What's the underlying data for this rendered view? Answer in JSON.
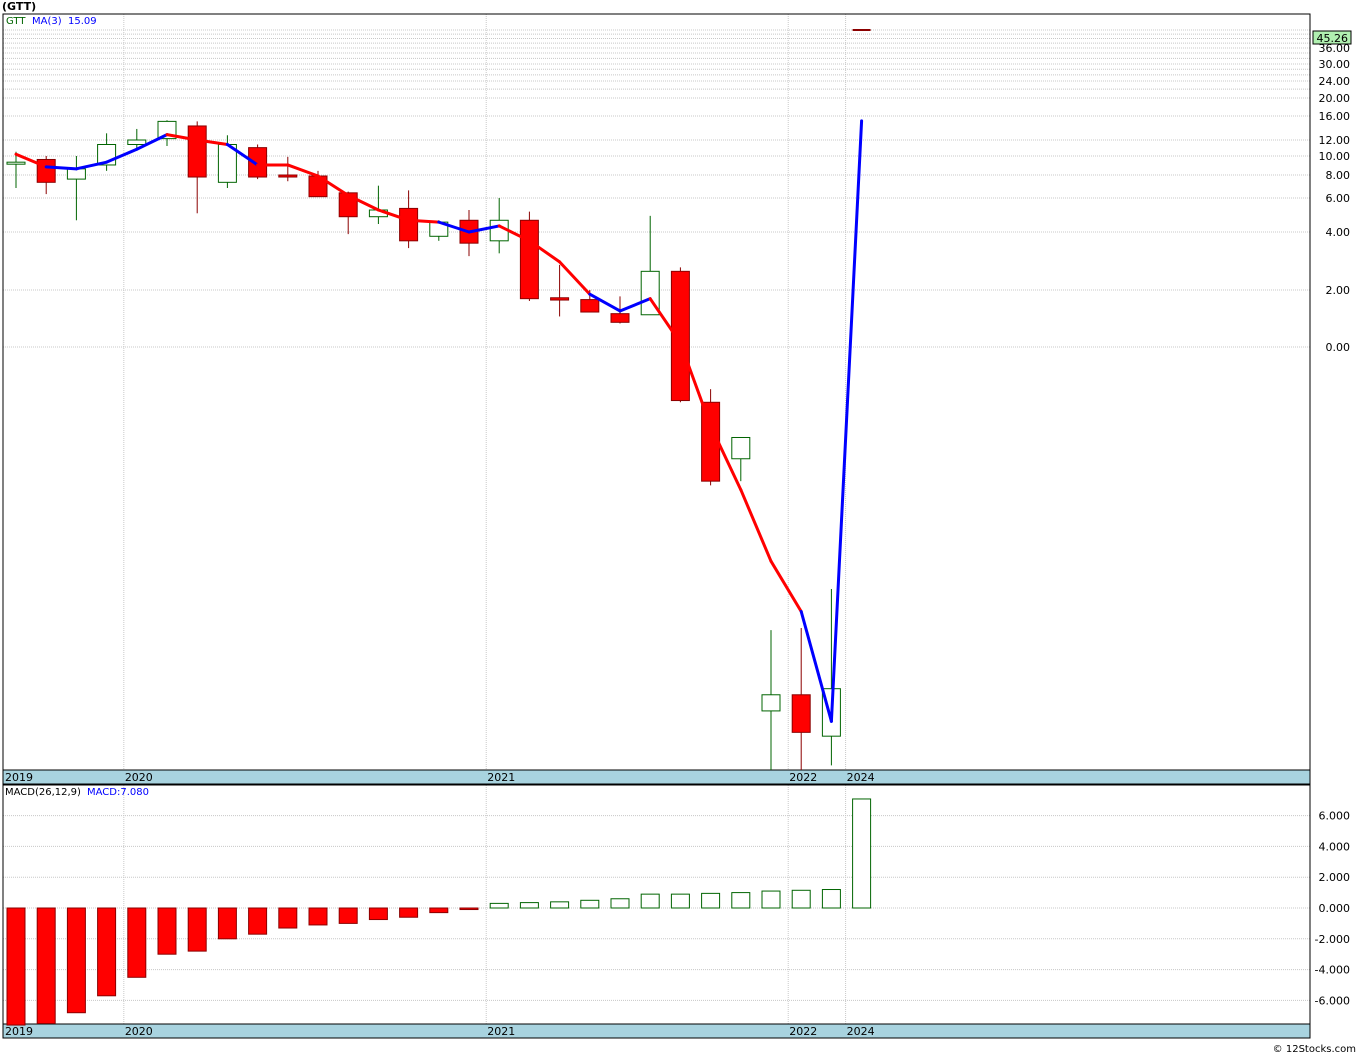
{
  "header": {
    "title": "(GTT)",
    "credit": "© 12Stocks.com"
  },
  "colors": {
    "up": "#006400",
    "down": "#ff0000",
    "ma_down": "#ff0000",
    "ma_up": "#0000ff",
    "axis_band": "#a8d3df",
    "grid": "#c8c8c8",
    "last_price_bg": "#b0f0b0"
  },
  "chart_data": [
    {
      "type": "candlestick",
      "title": "(GTT)",
      "legend": [
        "GTT",
        "MA(3)",
        "15.09"
      ],
      "last_price_label": "45.26",
      "scale": "log",
      "y_ticks": [
        "36.00",
        "30.00",
        "24.00",
        "20.00",
        "16.00",
        "12.00",
        "10.00",
        "8.00",
        "6.00",
        "4.00",
        "2.00",
        "0.00"
      ],
      "x_labels": [
        "2019",
        "2020",
        "2021",
        "2022",
        "2024"
      ],
      "candles": [
        {
          "o": 9.3,
          "h": 10.5,
          "l": 6.8,
          "c": 9.3
        },
        {
          "o": 9.6,
          "h": 10.0,
          "l": 6.3,
          "c": 7.3
        },
        {
          "o": 7.6,
          "h": 10.0,
          "l": 4.6,
          "c": 8.6
        },
        {
          "o": 9.0,
          "h": 13.0,
          "l": 8.4,
          "c": 11.4
        },
        {
          "o": 11.4,
          "h": 13.7,
          "l": 10.8,
          "c": 12.0
        },
        {
          "o": 12.2,
          "h": 15.2,
          "l": 11.2,
          "c": 15.0
        },
        {
          "o": 14.2,
          "h": 15.0,
          "l": 5.0,
          "c": 7.8
        },
        {
          "o": 7.3,
          "h": 12.7,
          "l": 6.8,
          "c": 11.4
        },
        {
          "o": 11.0,
          "h": 11.4,
          "l": 7.6,
          "c": 7.8
        },
        {
          "o": 8.0,
          "h": 9.9,
          "l": 7.4,
          "c": 7.8
        },
        {
          "o": 7.9,
          "h": 8.4,
          "l": 6.1,
          "c": 6.1
        },
        {
          "o": 6.4,
          "h": 6.5,
          "l": 3.9,
          "c": 4.8
        },
        {
          "o": 4.8,
          "h": 7.0,
          "l": 4.4,
          "c": 5.2
        },
        {
          "o": 5.3,
          "h": 6.6,
          "l": 3.3,
          "c": 3.6
        },
        {
          "o": 3.8,
          "h": 4.6,
          "l": 3.6,
          "c": 4.5
        },
        {
          "o": 4.6,
          "h": 5.2,
          "l": 3.0,
          "c": 3.5
        },
        {
          "o": 3.6,
          "h": 6.0,
          "l": 3.1,
          "c": 4.6
        },
        {
          "o": 4.6,
          "h": 5.1,
          "l": 1.75,
          "c": 1.8
        },
        {
          "o": 1.82,
          "h": 2.7,
          "l": 1.45,
          "c": 1.77
        },
        {
          "o": 1.78,
          "h": 2.0,
          "l": 1.55,
          "c": 1.53
        },
        {
          "o": 1.5,
          "h": 1.85,
          "l": 1.33,
          "c": 1.35
        },
        {
          "o": 1.48,
          "h": 4.85,
          "l": 1.48,
          "c": 2.5
        },
        {
          "o": 2.5,
          "h": 2.62,
          "l": 0.58,
          "c": 0.59
        },
        {
          "o": 0.58,
          "h": 0.66,
          "l": 0.27,
          "c": 0.28
        },
        {
          "o": 0.34,
          "h": 0.35,
          "l": 0.28,
          "c": 0.41
        },
        {
          "o": 0.055,
          "h": 0.085,
          "l": 0.035,
          "c": 0.06
        },
        {
          "o": 0.06,
          "h": 0.086,
          "l": 0.035,
          "c": 0.049
        },
        {
          "o": 0.048,
          "h": 0.11,
          "l": 0.041,
          "c": 0.062
        },
        {
          "o": 44.0,
          "h": 44.0,
          "l": 44.0,
          "c": 44.0
        }
      ],
      "ma": [
        10.2,
        8.8,
        8.6,
        9.3,
        10.8,
        12.8,
        12.0,
        11.4,
        9.0,
        9.0,
        7.9,
        6.2,
        5.2,
        4.6,
        4.5,
        4.0,
        4.3,
        3.6,
        2.8,
        1.9,
        1.55,
        1.8,
        1.05,
        0.46,
        0.26,
        0.14,
        0.094,
        0.052,
        15.09
      ],
      "ma_rising": [
        false,
        false,
        true,
        true,
        true,
        true,
        false,
        false,
        true,
        false,
        false,
        false,
        false,
        false,
        false,
        true,
        true,
        false,
        false,
        false,
        true,
        true,
        false,
        false,
        false,
        false,
        false,
        true,
        true
      ]
    },
    {
      "type": "bar",
      "title": "MACD(26,12,9)",
      "legend": [
        "MACD(26,12,9)",
        "MACD:7.080"
      ],
      "y_ticks": [
        "6.000",
        "4.000",
        "2.000",
        "0.000",
        "-2.000",
        "-4.000",
        "-6.000"
      ],
      "x_labels": [
        "2019",
        "2020",
        "2021",
        "2022",
        "2024"
      ],
      "values": [
        -7.6,
        -7.5,
        -6.8,
        -5.7,
        -4.5,
        -3.0,
        -2.8,
        -2.0,
        -1.7,
        -1.3,
        -1.1,
        -1.0,
        -0.75,
        -0.6,
        -0.3,
        -0.1,
        0.3,
        0.35,
        0.4,
        0.5,
        0.6,
        0.9,
        0.9,
        0.95,
        1.0,
        1.1,
        1.15,
        1.2,
        7.08
      ]
    }
  ]
}
